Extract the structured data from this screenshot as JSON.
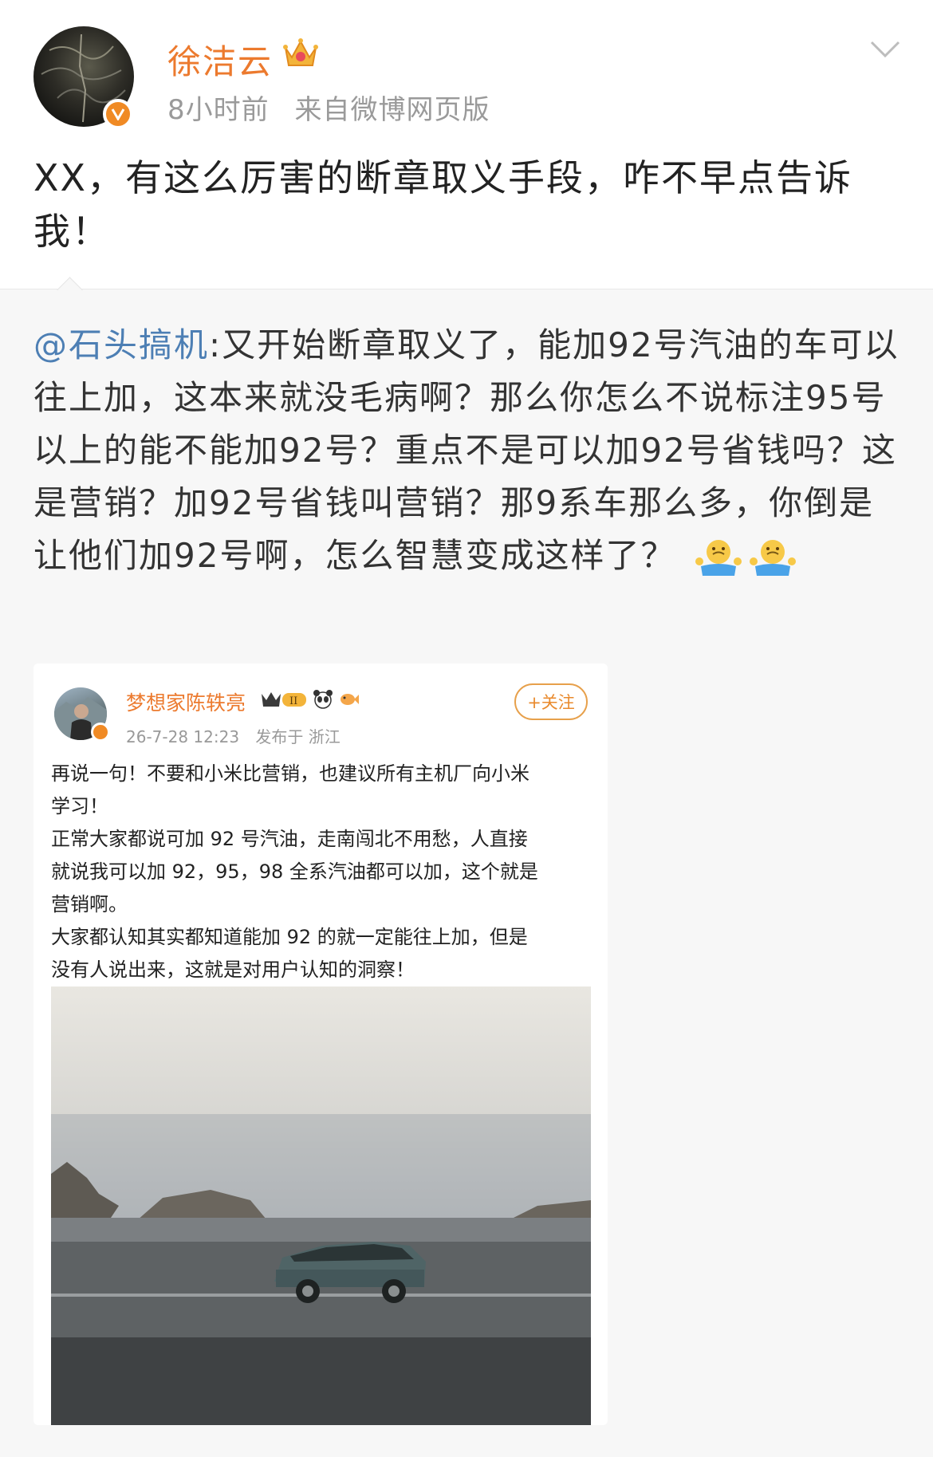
{
  "post": {
    "username": "徐洁云",
    "time": "8小时前",
    "source": "来自微博网页版",
    "text": "XX，有这么厉害的断章取义手段，咋不早点告诉我！"
  },
  "quote": {
    "mention": "@石头搞机",
    "text": ":又开始断章取义了，能加92号汽油的车可以往上加，这本来就没毛病啊？那么你怎么不说标注95号以上的能不能加92号？重点不是可以加92号省钱吗？这是营销？加92号省钱叫营销？那9系车那么多，你倒是让他们加92号啊，怎么智慧变成这样了？"
  },
  "embedded_post": {
    "username": "梦想家陈轶亮",
    "time": "26-7-28 12:23",
    "location": "发布于 浙江",
    "follow_label": "+关注",
    "lines": [
      "再说一句！不要和小米比营销，也建议所有主机厂向小米",
      "学习！",
      "正常大家都说可加 92 号汽油，走南闯北不用愁，人直接",
      "就说我可以加 92，95，98 全系汽油都可以加，这个就是",
      "营销啊。",
      "大家都认知其实都知道能加 92 的就一定能往上加，但是",
      "没有人说出来，这就是对用户认知的洞察！"
    ]
  },
  "icons": {
    "crown": "crown-icon",
    "verified": "verified-v-icon",
    "chevron": "chevron-down-icon",
    "shrug": "shrug-emoji-icon"
  },
  "colors": {
    "username": "#ec7a2e",
    "mention": "#4d7fb4",
    "verified": "#f08a24"
  }
}
